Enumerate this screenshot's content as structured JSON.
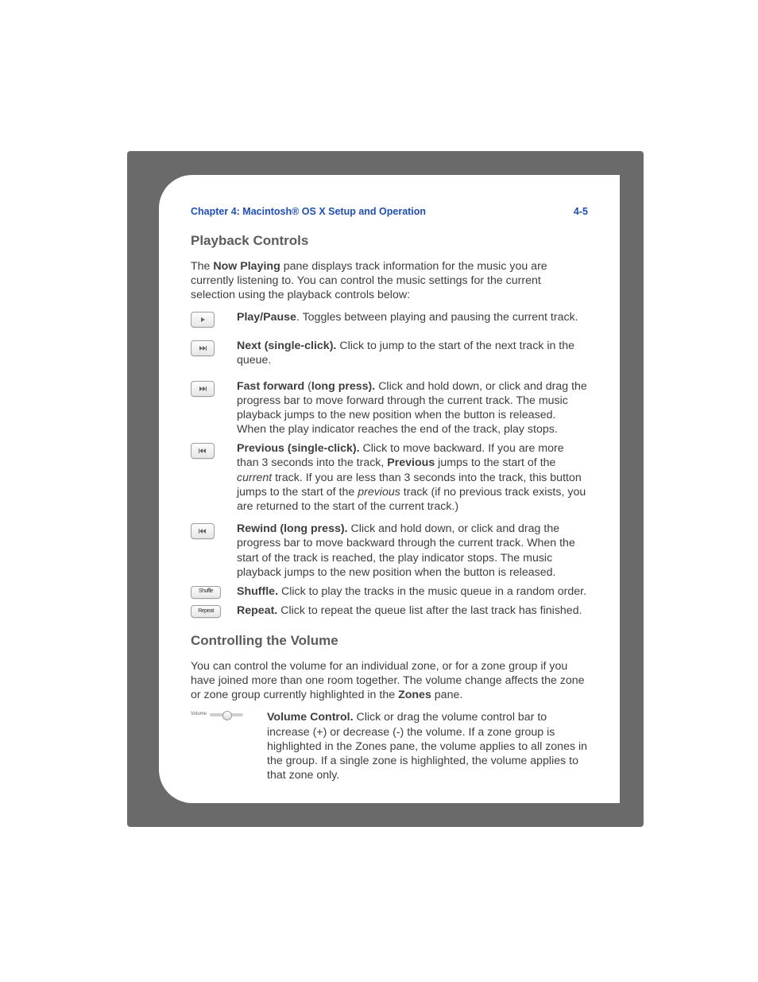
{
  "header": {
    "chapter": "Chapter 4:  Macintosh® OS X Setup and Operation",
    "page_number": "4-5"
  },
  "section1": {
    "title": "Playback Controls",
    "intro_pre": "The ",
    "intro_bold": "Now Playing",
    "intro_post": " pane displays track information for the music you are currently listening to. You can control the music settings for the current selection using the playback controls below:",
    "items": [
      {
        "label": "Play/Pause",
        "sep": ". ",
        "text": "Toggles between playing and pausing the current track."
      },
      {
        "label": "Next (single-click).",
        "sep": " ",
        "text": "Click to jump to the start of the next track in the queue."
      },
      {
        "label_pre": "Fast forward",
        "label_mid_plain": " (",
        "label_mid_bold": "long press).",
        "sep": " ",
        "text": "Click and hold down, or click and drag the progress bar to move forward through the current track. The music playback jumps to the new position when the button is released. When the play indicator reaches the end of the track, play stops."
      },
      {
        "label": "Previous (single-click).",
        "sep": " ",
        "text_parts": [
          {
            "t": "Click to move backward. If you are more than 3 seconds into the track, "
          },
          {
            "t": "Previous",
            "b": true
          },
          {
            "t": " jumps to the start of the "
          },
          {
            "t": "current",
            "i": true
          },
          {
            "t": " track. If you are less than 3 seconds into the track, this button jumps to the start of the "
          },
          {
            "t": "previous",
            "i": true
          },
          {
            "t": " track (if no previous track exists, you are returned to the start of the current track.)"
          }
        ]
      },
      {
        "label": "Rewind (long press).",
        "sep": " ",
        "text": "Click and hold down, or click and drag the progress bar to move backward through the current track. When the start of the track is reached, the play indicator stops. The music playback jumps to the new position when the button is released."
      },
      {
        "label": "Shuffle.",
        "sep": " ",
        "text": "Click to play the tracks in the music queue in a random order."
      },
      {
        "label": "Repeat.",
        "sep": " ",
        "text": "Click to repeat the queue list after the last track has finished."
      }
    ],
    "shuffle_btn": "Shuffle",
    "repeat_btn": "Repeat"
  },
  "section2": {
    "title": "Controlling the Volume",
    "intro_pre": "You can control the volume for an individual zone, or for a zone group if you have joined more than one room together. The volume change affects the zone or zone group currently highlighted in the ",
    "intro_bold": "Zones",
    "intro_post": " pane.",
    "vol_label": "Volume",
    "item": {
      "label": "Volume Control.",
      "sep": "  ",
      "text": "Click or drag the volume control bar to increase (+) or decrease (-) the volume. If a zone group is highlighted in the Zones pane, the volume applies to all zones in the group. If a single zone is highlighted, the volume applies to that zone only."
    }
  }
}
